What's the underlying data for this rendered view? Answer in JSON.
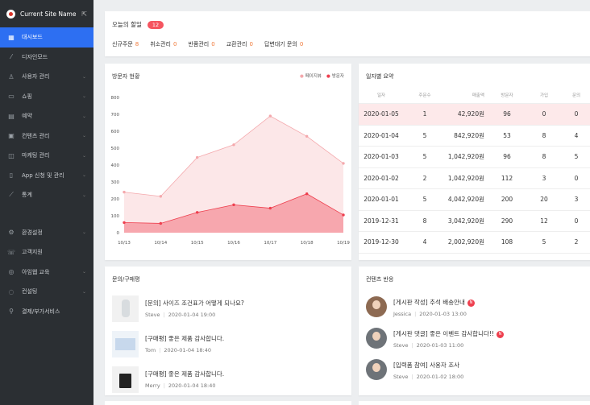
{
  "site": {
    "name": "Current Site Name"
  },
  "sidebar": {
    "items": [
      {
        "label": "대시보드",
        "icon": "dashboard-icon",
        "active": true
      },
      {
        "label": "디자인모드",
        "icon": "wand-icon"
      },
      {
        "label": "사용자 관리",
        "icon": "user-icon"
      },
      {
        "label": "쇼핑",
        "icon": "bag-icon"
      },
      {
        "label": "예약",
        "icon": "calendar-icon"
      },
      {
        "label": "컨텐츠 관리",
        "icon": "content-icon"
      },
      {
        "label": "마케팅 관리",
        "icon": "marketing-icon"
      },
      {
        "label": "App 신청 및 관리",
        "icon": "phone-icon"
      },
      {
        "label": "통계",
        "icon": "stats-icon"
      }
    ],
    "items2": [
      {
        "label": "환경설정",
        "icon": "gear-icon"
      },
      {
        "label": "고객지원",
        "icon": "support-icon"
      },
      {
        "label": "아임웹 교육",
        "icon": "education-icon"
      },
      {
        "label": "컨설팅",
        "icon": "consulting-icon"
      },
      {
        "label": "결제/부가서비스",
        "icon": "link-icon"
      }
    ]
  },
  "todo": {
    "title": "오늘의 할일",
    "count": "12",
    "items": [
      {
        "label": "신규주문",
        "n": "8"
      },
      {
        "label": "취소관리",
        "n": "0"
      },
      {
        "label": "반품관리",
        "n": "0"
      },
      {
        "label": "교환관리",
        "n": "0"
      },
      {
        "label": "답변대기 문의",
        "n": "0"
      }
    ]
  },
  "visit": {
    "title": "방문자 현황",
    "legend": [
      "페이지뷰",
      "방문자"
    ]
  },
  "chart_data": {
    "type": "area",
    "x": [
      "10/13",
      "10/14",
      "10/15",
      "10/16",
      "10/17",
      "10/18",
      "10/19"
    ],
    "ylim": [
      0,
      800
    ],
    "yticks": [
      0,
      100,
      200,
      300,
      400,
      500,
      600,
      700,
      800
    ],
    "series": [
      {
        "name": "페이지뷰",
        "values": [
          240,
          215,
          445,
          520,
          690,
          570,
          410
        ],
        "color": "#f4a8ac"
      },
      {
        "name": "방문자",
        "values": [
          60,
          55,
          120,
          165,
          145,
          230,
          105
        ],
        "color": "#ee3f4e"
      }
    ],
    "grid": false,
    "legend": "top-right"
  },
  "daily": {
    "title": "일자별 요약",
    "headers": [
      "일자",
      "주문수",
      "매출액",
      "방문자",
      "가입",
      "문의"
    ],
    "rows": [
      [
        "2020-01-05",
        "1",
        "42,920원",
        "96",
        "0",
        "0"
      ],
      [
        "2020-01-04",
        "5",
        "842,920원",
        "53",
        "8",
        "4"
      ],
      [
        "2020-01-03",
        "5",
        "1,042,920원",
        "96",
        "8",
        "5"
      ],
      [
        "2020-01-02",
        "2",
        "1,042,920원",
        "112",
        "3",
        "0"
      ],
      [
        "2020-01-01",
        "5",
        "4,042,920원",
        "200",
        "20",
        "3"
      ],
      [
        "2019-12-31",
        "8",
        "3,042,920원",
        "290",
        "12",
        "0"
      ],
      [
        "2019-12-30",
        "4",
        "2,002,920원",
        "108",
        "5",
        "2"
      ]
    ]
  },
  "inquiry": {
    "title": "문의/구매평",
    "items": [
      {
        "title": "[문의] 사이즈 조건표가 어떻게 되나요?",
        "author": "Steve",
        "date": "2020-01-04 19:00"
      },
      {
        "title": "[구매평] 좋은 제품 감사합니다.",
        "author": "Tom",
        "date": "2020-01-04 18:40"
      },
      {
        "title": "[구매평] 좋은 제품 감사합니다.",
        "author": "Merry",
        "date": "2020-01-04 18:40"
      }
    ]
  },
  "reaction": {
    "title": "컨텐츠 반응",
    "items": [
      {
        "title": "[게시판 작성] 추석 배송안내",
        "author": "Jessica",
        "date": "2020-01-03 13:00",
        "new": "N"
      },
      {
        "title": "[게시판 댓글] 좋은 이벤트 감사합니다!!",
        "author": "Steve",
        "date": "2020-01-03 11:00",
        "new": "N"
      },
      {
        "title": "[입력폼 참여] 사용자 조사",
        "author": "Steve",
        "date": "2020-01-02 18:00"
      }
    ]
  }
}
